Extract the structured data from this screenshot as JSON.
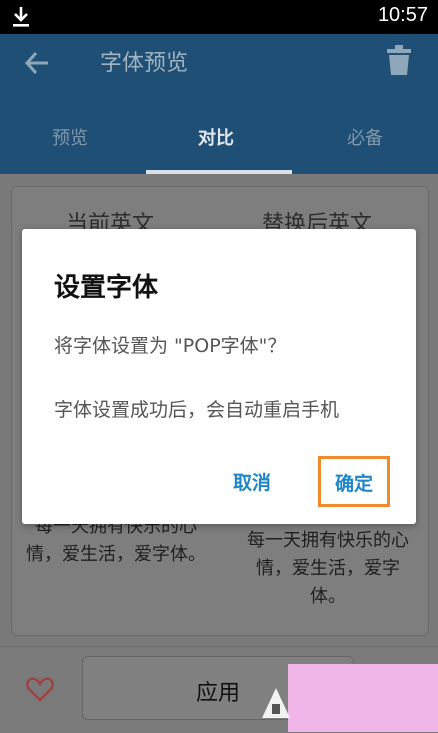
{
  "status_bar": {
    "time": "10:57",
    "download_icon": "download-icon"
  },
  "app_bar": {
    "title": "字体预览",
    "back_icon": "back-arrow-icon",
    "delete_icon": "trash-icon",
    "tabs": [
      {
        "label": "预览",
        "selected": false
      },
      {
        "label": "对比",
        "selected": true
      },
      {
        "label": "必备",
        "selected": false
      }
    ]
  },
  "compare": {
    "left_header": "当前英文",
    "right_header": "替换后英文",
    "left_sample": "每一天拥有快乐的心情，爱生活，爱字体。",
    "right_sample_lines": [
      "每一天拥有快乐的心",
      "情，爱生活，爱字",
      "体。"
    ]
  },
  "bottom": {
    "apply_label": "应用",
    "favorite_icon": "heart-icon"
  },
  "dialog": {
    "title": "设置字体",
    "message1": "将字体设置为 \"POP字体\"？",
    "message2": "字体设置成功后，会自动重启手机",
    "cancel_label": "取消",
    "ok_label": "确定"
  },
  "colors": {
    "accent": "#1f86c8",
    "highlight": "#f08a2c",
    "app_bar": "#2a74ad"
  }
}
